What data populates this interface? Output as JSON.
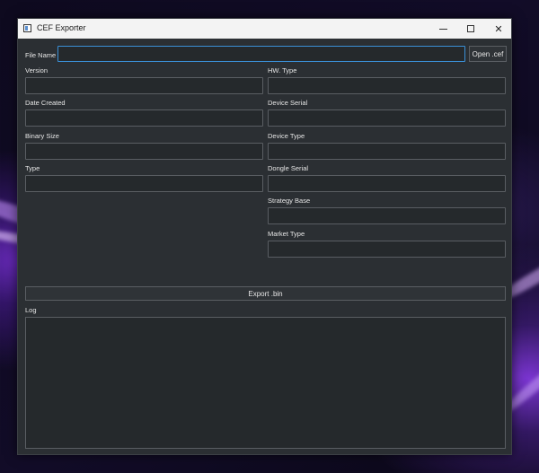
{
  "window": {
    "title": "CEF Exporter"
  },
  "file_name": {
    "label": "File Name",
    "value": ""
  },
  "open_button": {
    "label": "Open .cef"
  },
  "left_fields": [
    {
      "label": "Version",
      "value": ""
    },
    {
      "label": "Date Created",
      "value": ""
    },
    {
      "label": "Binary Size",
      "value": ""
    },
    {
      "label": "Type",
      "value": ""
    }
  ],
  "right_fields": [
    {
      "label": "HW. Type",
      "value": ""
    },
    {
      "label": "Device Serial",
      "value": ""
    },
    {
      "label": "Device Type",
      "value": ""
    },
    {
      "label": "Dongle Serial",
      "value": ""
    },
    {
      "label": "Strategy Base",
      "value": ""
    },
    {
      "label": "Market Type",
      "value": ""
    }
  ],
  "export_button": {
    "label": "Export .bin"
  },
  "log": {
    "label": "Log",
    "value": ""
  },
  "colors": {
    "background": "#2b2f33",
    "field": "#25292c",
    "border": "#5a5e63",
    "focus": "#3a8fd6",
    "text": "#e6e6e6"
  }
}
